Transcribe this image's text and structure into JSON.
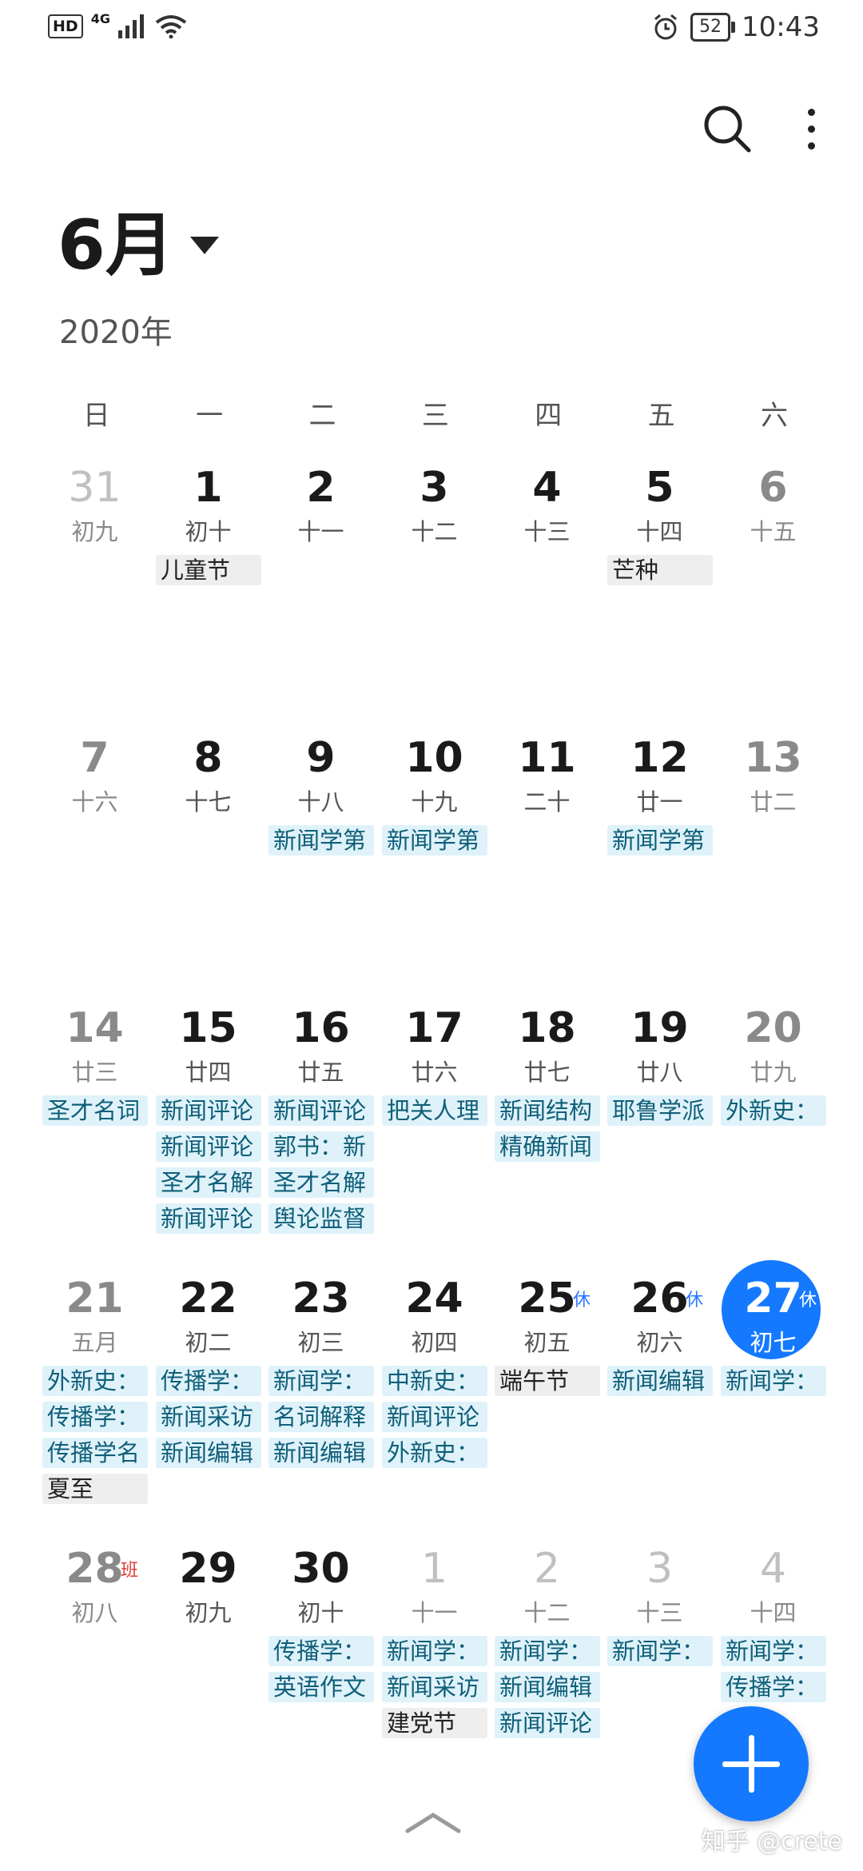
{
  "status": {
    "hd": "HD",
    "network": "4G",
    "battery": "52",
    "time": "10:43"
  },
  "header": {
    "month": "6月",
    "year": "2020年"
  },
  "weekdays": [
    "日",
    "一",
    "二",
    "三",
    "四",
    "五",
    "六"
  ],
  "weeks": [
    [
      {
        "day": "31",
        "lunar": "初九",
        "other": true,
        "events": []
      },
      {
        "day": "1",
        "lunar": "初十",
        "events": [
          {
            "t": "儿童节",
            "k": "holiday"
          }
        ]
      },
      {
        "day": "2",
        "lunar": "十一",
        "events": []
      },
      {
        "day": "3",
        "lunar": "十二",
        "events": []
      },
      {
        "day": "4",
        "lunar": "十三",
        "events": []
      },
      {
        "day": "5",
        "lunar": "十四",
        "events": [
          {
            "t": "芒种",
            "k": "holiday"
          }
        ]
      },
      {
        "day": "6",
        "lunar": "十五",
        "events": []
      }
    ],
    [
      {
        "day": "7",
        "lunar": "十六",
        "events": []
      },
      {
        "day": "8",
        "lunar": "十七",
        "events": []
      },
      {
        "day": "9",
        "lunar": "十八",
        "events": [
          {
            "t": "新闻学第"
          }
        ]
      },
      {
        "day": "10",
        "lunar": "十九",
        "events": [
          {
            "t": "新闻学第"
          }
        ]
      },
      {
        "day": "11",
        "lunar": "二十",
        "events": []
      },
      {
        "day": "12",
        "lunar": "廿一",
        "events": [
          {
            "t": "新闻学第"
          }
        ]
      },
      {
        "day": "13",
        "lunar": "廿二",
        "events": []
      }
    ],
    [
      {
        "day": "14",
        "lunar": "廿三",
        "events": [
          {
            "t": "圣才名词"
          }
        ]
      },
      {
        "day": "15",
        "lunar": "廿四",
        "events": [
          {
            "t": "新闻评论"
          },
          {
            "t": "新闻评论"
          },
          {
            "t": "圣才名解"
          },
          {
            "t": "新闻评论"
          }
        ]
      },
      {
        "day": "16",
        "lunar": "廿五",
        "events": [
          {
            "t": "新闻评论"
          },
          {
            "t": "郭书：新"
          },
          {
            "t": "圣才名解"
          },
          {
            "t": "舆论监督"
          }
        ]
      },
      {
        "day": "17",
        "lunar": "廿六",
        "events": [
          {
            "t": "把关人理"
          }
        ]
      },
      {
        "day": "18",
        "lunar": "廿七",
        "events": [
          {
            "t": "新闻结构"
          },
          {
            "t": "精确新闻"
          }
        ]
      },
      {
        "day": "19",
        "lunar": "廿八",
        "events": [
          {
            "t": "耶鲁学派"
          }
        ]
      },
      {
        "day": "20",
        "lunar": "廿九",
        "events": [
          {
            "t": "外新史："
          }
        ]
      }
    ],
    [
      {
        "day": "21",
        "lunar": "五月",
        "events": [
          {
            "t": "外新史："
          },
          {
            "t": "传播学："
          },
          {
            "t": "传播学名"
          },
          {
            "t": "夏至",
            "k": "holiday"
          }
        ]
      },
      {
        "day": "22",
        "lunar": "初二",
        "events": [
          {
            "t": "传播学："
          },
          {
            "t": "新闻采访"
          },
          {
            "t": "新闻编辑"
          }
        ]
      },
      {
        "day": "23",
        "lunar": "初三",
        "events": [
          {
            "t": "新闻学："
          },
          {
            "t": "名词解释"
          },
          {
            "t": "新闻编辑"
          }
        ]
      },
      {
        "day": "24",
        "lunar": "初四",
        "events": [
          {
            "t": "中新史："
          },
          {
            "t": "新闻评论"
          },
          {
            "t": "外新史："
          }
        ]
      },
      {
        "day": "25",
        "lunar": "初五",
        "badge": "休",
        "events": [
          {
            "t": "端午节",
            "k": "holiday"
          }
        ]
      },
      {
        "day": "26",
        "lunar": "初六",
        "badge": "休",
        "events": [
          {
            "t": "新闻编辑"
          }
        ]
      },
      {
        "day": "27",
        "lunar": "初七",
        "badge": "休",
        "today": true,
        "events": [
          {
            "t": "新闻学："
          }
        ]
      }
    ],
    [
      {
        "day": "28",
        "lunar": "初八",
        "badge": "班",
        "badgeRed": true,
        "events": []
      },
      {
        "day": "29",
        "lunar": "初九",
        "events": []
      },
      {
        "day": "30",
        "lunar": "初十",
        "events": [
          {
            "t": "传播学："
          },
          {
            "t": "英语作文"
          }
        ]
      },
      {
        "day": "1",
        "lunar": "十一",
        "other": true,
        "events": [
          {
            "t": "新闻学："
          },
          {
            "t": "新闻采访"
          },
          {
            "t": "建党节",
            "k": "holiday"
          }
        ]
      },
      {
        "day": "2",
        "lunar": "十二",
        "other": true,
        "events": [
          {
            "t": "新闻学："
          },
          {
            "t": "新闻编辑"
          },
          {
            "t": "新闻评论"
          }
        ]
      },
      {
        "day": "3",
        "lunar": "十三",
        "other": true,
        "events": [
          {
            "t": "新闻学："
          }
        ]
      },
      {
        "day": "4",
        "lunar": "十四",
        "other": true,
        "events": [
          {
            "t": "新闻学："
          },
          {
            "t": "传播学："
          }
        ]
      }
    ]
  ],
  "watermark": "知乎 @crete",
  "colors": {
    "accent": "#1479ff",
    "event_bg": "#dff2fa",
    "event_text": "#0f5f78",
    "holiday_bg": "#eeeeee"
  }
}
